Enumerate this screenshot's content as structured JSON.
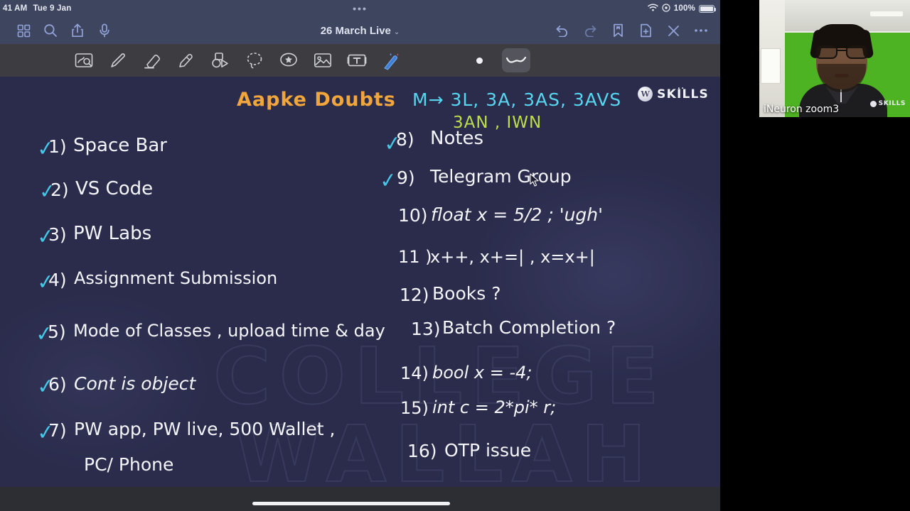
{
  "status_bar": {
    "time": "41 AM",
    "date": "Tue 9 Jan",
    "center_dots": "•••",
    "battery_pct": "100%",
    "wifi_icon": "wifi-icon",
    "location_icon": "location-icon"
  },
  "app_toolbar": {
    "title": "26 March Live",
    "chevron": "⌄",
    "left_icons": [
      {
        "name": "library-grid-icon",
        "label": "Library"
      },
      {
        "name": "search-icon",
        "label": "Search"
      },
      {
        "name": "share-icon",
        "label": "Share"
      },
      {
        "name": "microphone-icon",
        "label": "Record audio"
      }
    ],
    "right_icons": [
      {
        "name": "undo-icon",
        "label": "Undo"
      },
      {
        "name": "redo-icon",
        "label": "Redo"
      },
      {
        "name": "bookmark-icon",
        "label": "Bookmark"
      },
      {
        "name": "add-page-icon",
        "label": "New page"
      },
      {
        "name": "close-icon",
        "label": "Close"
      },
      {
        "name": "more-icon",
        "label": "More"
      }
    ]
  },
  "pen_toolbar": {
    "tools": [
      {
        "name": "zoom-box-icon",
        "label": "Zoom box"
      },
      {
        "name": "pen-icon",
        "label": "Pen"
      },
      {
        "name": "eraser-icon",
        "label": "Eraser"
      },
      {
        "name": "highlighter-icon",
        "label": "Highlighter"
      },
      {
        "name": "shapes-icon",
        "label": "Shapes"
      },
      {
        "name": "lasso-icon",
        "label": "Lasso"
      },
      {
        "name": "sticker-icon",
        "label": "Sticker"
      },
      {
        "name": "image-icon",
        "label": "Image"
      },
      {
        "name": "text-box-icon",
        "label": "Text box"
      },
      {
        "name": "magic-wand-icon",
        "label": "Magic wand"
      }
    ],
    "stroke_size_label": "•",
    "stroke_style_label": "～"
  },
  "note": {
    "heading_left": "Aapke   Doubts",
    "heading_right_line1": "M→ 3L, 3A, 3AS, 3AVS",
    "heading_right_line2": "3AN ,  IWN",
    "watermark_line1": "COLLEGE",
    "watermark_line2": "WALLAH",
    "logo": {
      "word": "SKILLS",
      "badge": "W",
      "dots": ".."
    },
    "left_items": [
      {
        "check": "✓",
        "num": "1)",
        "text": "Space  Bar"
      },
      {
        "check": "✓",
        "num": "2)",
        "text": "VS  Code"
      },
      {
        "check": "✓",
        "num": "3)",
        "text": "PW   Labs"
      },
      {
        "check": "✓",
        "num": "4)",
        "text": "Assignment   Submission"
      },
      {
        "check": "✓",
        "num": "5)",
        "text": "Mode  of  Classes , upload  time  & day"
      },
      {
        "check": "✓",
        "num": "6)",
        "text": "Cont  is  object"
      },
      {
        "check": "✓",
        "num": "7)",
        "text": "PW app,  PW live,  500 Wallet ,"
      },
      {
        "check": "",
        "num": "",
        "text": "PC/ Phone"
      }
    ],
    "right_items": [
      {
        "check": "✓",
        "num": "8)",
        "text": "Notes"
      },
      {
        "check": "✓",
        "num": "9)",
        "text": "Telegram  Group"
      },
      {
        "check": "",
        "num": "10)",
        "text": "float  x  =  5/2 ;  'ugh'"
      },
      {
        "check": "",
        "num": "11 )",
        "text": "x++, x+=| , x=x+|"
      },
      {
        "check": "",
        "num": "12)",
        "text": "Books ?"
      },
      {
        "check": "",
        "num": "13)",
        "text": "Batch  Completion ?"
      },
      {
        "check": "",
        "num": "14)",
        "text": "bool x = -4;"
      },
      {
        "check": "",
        "num": "15)",
        "text": "int c  = 2*pi* r;"
      },
      {
        "check": "",
        "num": "16)",
        "text": "OTP  issue"
      }
    ]
  },
  "webcam": {
    "participant_label": "iNeuron zoom3",
    "shirt_logo": "SKILLS"
  },
  "colors": {
    "canvas_bg": "#2b2c4c",
    "toolbar_bg": "#3d455f",
    "pen_toolbar_bg": "#3c3c41",
    "ink_white": "#f4f5fa",
    "ink_cyan": "#57d6f0",
    "ink_green": "#bede4a",
    "ink_orange": "#f0a63c",
    "check_cyan": "#45c8e8"
  }
}
